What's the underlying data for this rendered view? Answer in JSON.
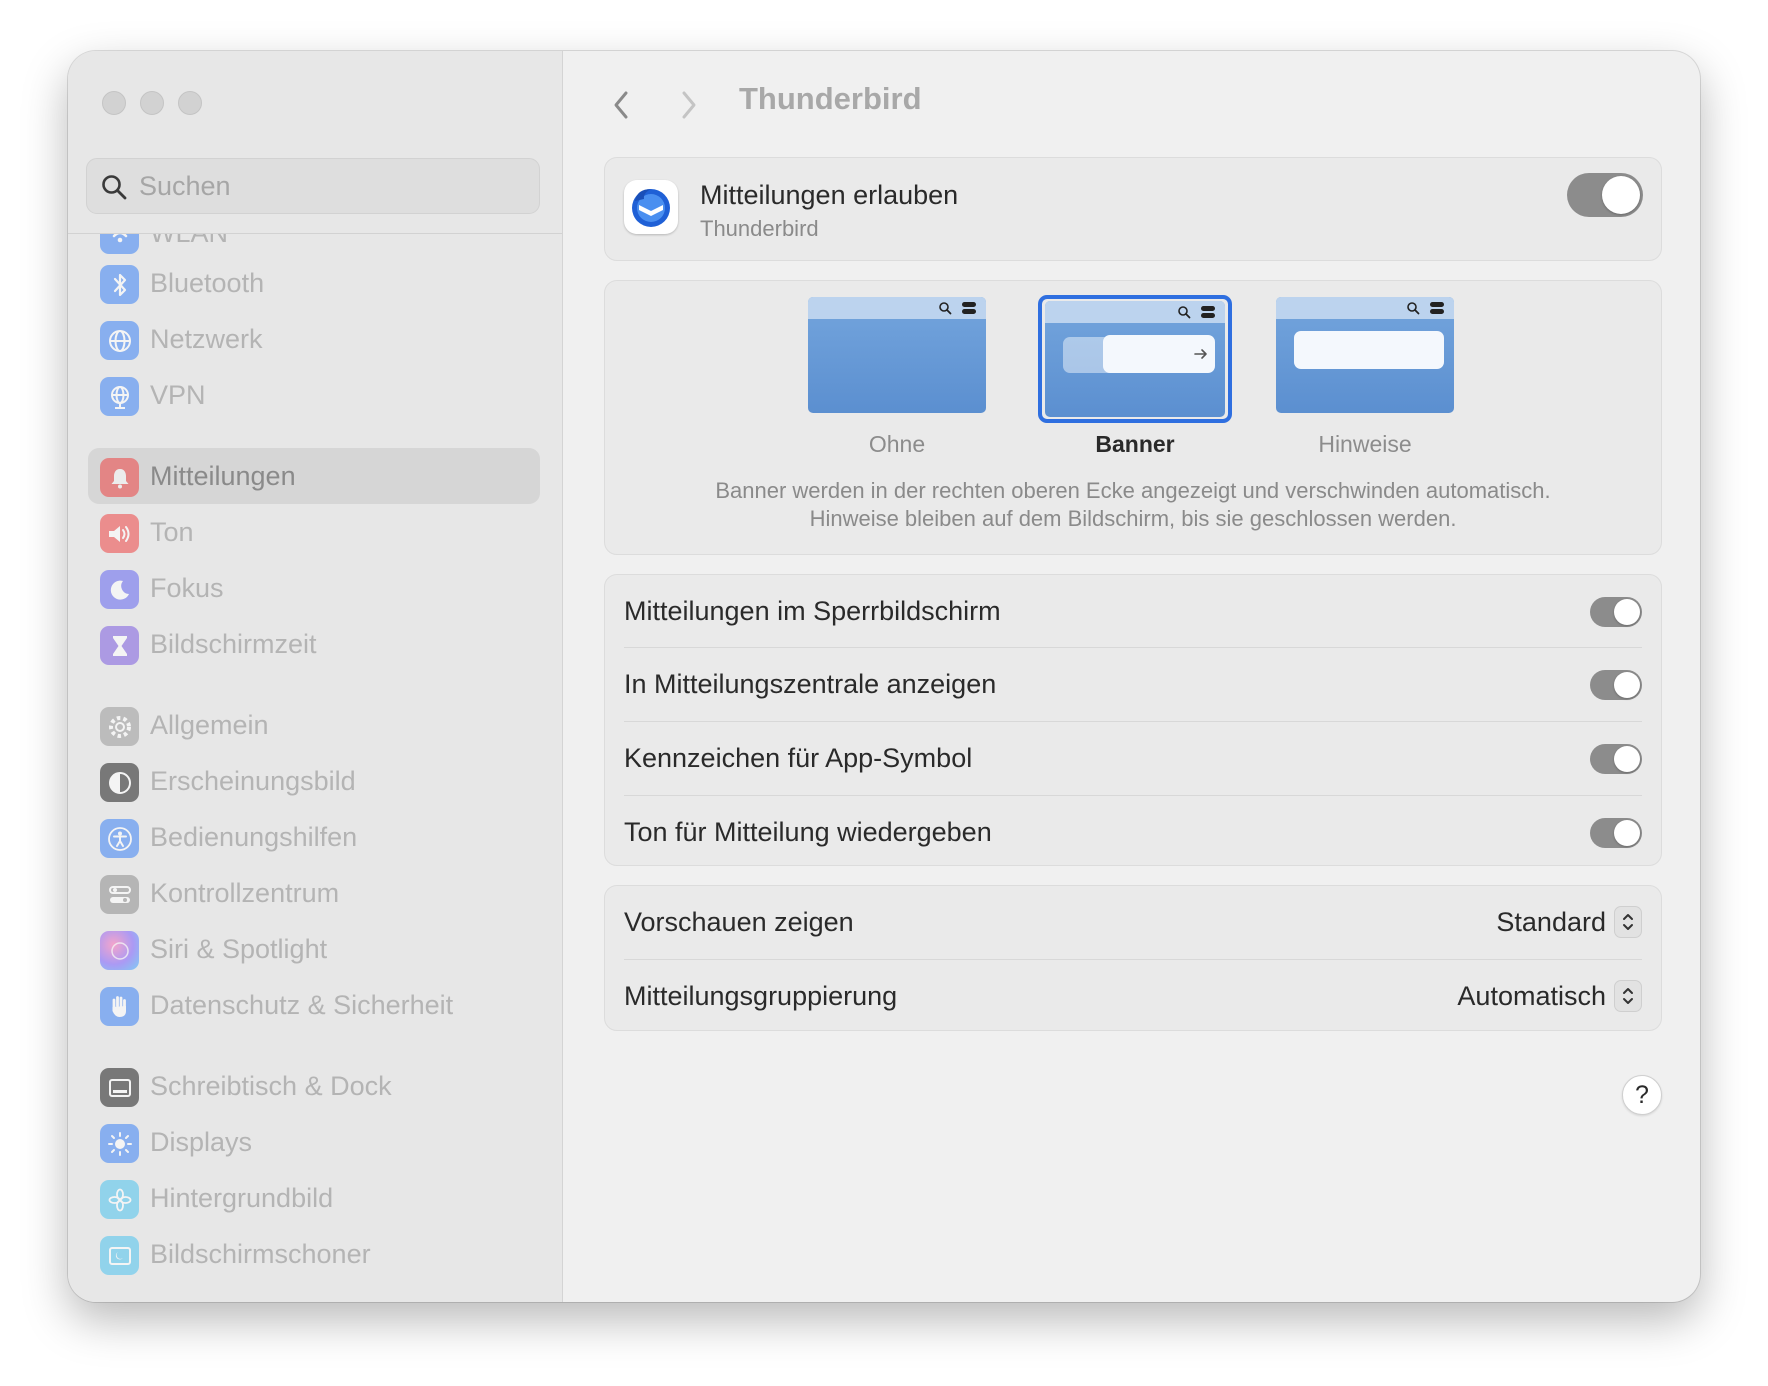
{
  "search": {
    "placeholder": "Suchen"
  },
  "sidebar": {
    "items": [
      {
        "label": "WLAN",
        "icon": "wifi-icon",
        "color": "#3b82f6"
      },
      {
        "label": "Bluetooth",
        "icon": "bluetooth-icon",
        "color": "#3b82f6"
      },
      {
        "label": "Netzwerk",
        "icon": "globe-icon",
        "color": "#3b82f6"
      },
      {
        "label": "VPN",
        "icon": "vpn-globe-icon",
        "color": "#3b82f6"
      },
      {
        "label": "Mitteilungen",
        "icon": "bell-icon",
        "color": "#ef4444",
        "selected": true
      },
      {
        "label": "Ton",
        "icon": "speaker-icon",
        "color": "#ef4444"
      },
      {
        "label": "Fokus",
        "icon": "moon-icon",
        "color": "#6366f1"
      },
      {
        "label": "Bildschirmzeit",
        "icon": "hourglass-icon",
        "color": "#7c5ce0"
      },
      {
        "label": "Allgemein",
        "icon": "gear-icon",
        "color": "#9a9a9a"
      },
      {
        "label": "Erscheinungsbild",
        "icon": "appearance-icon",
        "color": "#1f1f1f"
      },
      {
        "label": "Bedienungshilfen",
        "icon": "accessibility-icon",
        "color": "#3b82f6"
      },
      {
        "label": "Kontrollzentrum",
        "icon": "control-center-icon",
        "color": "#8e8e8e"
      },
      {
        "label": "Siri & Spotlight",
        "icon": "siri-icon",
        "color": "#b05bd6"
      },
      {
        "label": "Datenschutz & Sicherheit",
        "icon": "hand-icon",
        "color": "#3b82f6"
      },
      {
        "label": "Schreibtisch & Dock",
        "icon": "dock-icon",
        "color": "#1f1f1f"
      },
      {
        "label": "Displays",
        "icon": "sun-icon",
        "color": "#3b82f6"
      },
      {
        "label": "Hintergrundbild",
        "icon": "flower-icon",
        "color": "#4cc3f0"
      },
      {
        "label": "Bildschirmschoner",
        "icon": "screensaver-icon",
        "color": "#4cc3f0"
      }
    ]
  },
  "header": {
    "title": "Thunderbird"
  },
  "allow": {
    "title": "Mitteilungen erlauben",
    "subtitle": "Thunderbird",
    "enabled": true
  },
  "styles": {
    "options": [
      {
        "label": "Ohne"
      },
      {
        "label": "Banner",
        "selected": true
      },
      {
        "label": "Hinweise"
      }
    ],
    "description_line1": "Banner werden in der rechten oberen Ecke angezeigt und verschwinden automatisch.",
    "description_line2": "Hinweise bleiben auf dem Bildschirm, bis sie geschlossen werden."
  },
  "toggles": [
    {
      "label": "Mitteilungen im Sperrbildschirm",
      "on": true
    },
    {
      "label": "In Mitteilungszentrale anzeigen",
      "on": true
    },
    {
      "label": "Kennzeichen für App-Symbol",
      "on": true
    },
    {
      "label": "Ton für Mitteilung wiedergeben",
      "on": true
    }
  ],
  "selects": [
    {
      "label": "Vorschauen zeigen",
      "value": "Standard"
    },
    {
      "label": "Mitteilungsgruppierung",
      "value": "Automatisch"
    }
  ],
  "help_label": "?",
  "accent_color": "#2f6fe0"
}
